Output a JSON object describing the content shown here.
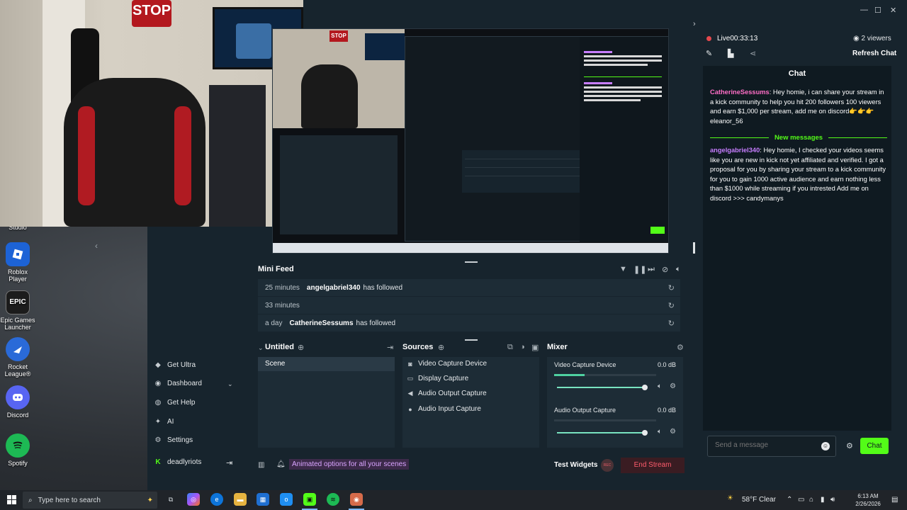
{
  "desktop_icons": [
    {
      "label": "Studio"
    },
    {
      "label": "Roblox Player"
    },
    {
      "label": "Epic Games Launcher",
      "icon_text": "EPIC"
    },
    {
      "label": "Rocket League®"
    },
    {
      "label": "Discord"
    },
    {
      "label": "Spotify"
    }
  ],
  "webcam": {
    "stop_sign": "STOP"
  },
  "sidebar": {
    "items": [
      {
        "label": "Get Ultra",
        "icon": "ultra-icon"
      },
      {
        "label": "Dashboard",
        "icon": "dashboard-icon"
      },
      {
        "label": "Get Help",
        "icon": "help-icon"
      },
      {
        "label": "AI",
        "icon": "ai-icon"
      },
      {
        "label": "Settings",
        "icon": "gear-icon"
      },
      {
        "label": "deadlyriots",
        "icon": "kick-icon"
      }
    ]
  },
  "mini_feed": {
    "title": "Mini Feed",
    "events": [
      {
        "time": "25 minutes",
        "user": "angelgabriel340",
        "action": "has followed"
      },
      {
        "time": "33 minutes",
        "user": "",
        "action": ""
      },
      {
        "time": "a day",
        "user": "CatherineSessums",
        "action": "has followed"
      }
    ]
  },
  "scenes": {
    "title": "Untitled",
    "items": [
      "Scene"
    ]
  },
  "sources": {
    "title": "Sources",
    "items": [
      "Video Capture Device",
      "Display Capture",
      "Audio Output Capture",
      "Audio Input Capture"
    ]
  },
  "mixer": {
    "title": "Mixer",
    "channels": [
      {
        "name": "Video Capture Device",
        "db": "0.0 dB",
        "level": 0.3,
        "volume": 1.0
      },
      {
        "name": "Audio Output Capture",
        "db": "0.0 dB",
        "level": 0.0,
        "volume": 1.0
      }
    ]
  },
  "footer": {
    "promo": "Animated options for all your scenes",
    "test_widgets": "Test Widgets",
    "rec": "REC",
    "end_stream": "End Stream"
  },
  "stream": {
    "status": "Live",
    "time": "00:33:13",
    "viewers": "2 viewers",
    "refresh": "Refresh Chat"
  },
  "chat": {
    "title": "Chat",
    "messages": [
      {
        "user": "CatherineSessums",
        "text": ": Hey homie, i can share your stream in a kick community to help you hit 200 followers 100 viewers and earn $1,000 per stream, add me on discord👉👉👉 eleanor_56"
      },
      {
        "user": "angelgabriel340",
        "text": ": Hey homie, I checked your videos seems like you are new in kick not yet affiliated and verified. I got a proposal for you by sharing your stream to a kick community for you to gain 1000 active audience and earn nothing less than $1000 while streaming if you intrested Add me on discord >>> candymanys"
      }
    ],
    "new_messages": "New messages",
    "input_placeholder": "Send a message",
    "send_label": "Chat"
  },
  "taskbar": {
    "search_placeholder": "Type here to search",
    "weather": "58°F  Clear",
    "time": "6:13 AM",
    "date": "2/26/2026"
  },
  "colors": {
    "accent": "#53fc18",
    "username": "#c77dff",
    "username_alt": "#ff6ec7",
    "end_stream": "#ff5c6c"
  }
}
